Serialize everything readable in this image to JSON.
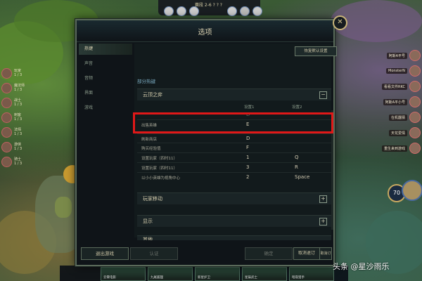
{
  "hud": {
    "stage": "赛段 2-6  ? ? ?",
    "left_players": [
      {
        "name": "玩家\n1 / 3"
      },
      {
        "name": "魔法师\n1 / 3"
      },
      {
        "name": "战士\n1 / 3"
      },
      {
        "name": "刺客\n1 / 3"
      },
      {
        "name": "法师\n1 / 3"
      },
      {
        "name": "游侠\n1 / 3"
      },
      {
        "name": "骑士\n1 / 3"
      }
    ],
    "right_players": [
      {
        "name": "阿斯A平号"
      },
      {
        "name": "MonsterN"
      },
      {
        "name": "看看文件RKC"
      },
      {
        "name": "阿斯A平小号"
      },
      {
        "name": "在机器猜"
      },
      {
        "name": "天花爱情"
      },
      {
        "name": "重生来到游戏"
      }
    ],
    "level": "70",
    "bench_cards": [
      {
        "name": "云霄电影"
      },
      {
        "name": "九尾狐狸"
      },
      {
        "name": "新星护卫"
      },
      {
        "name": "星辰武士"
      },
      {
        "name": "暗夜猎手"
      }
    ]
  },
  "dialog": {
    "title": "选项",
    "close_glyph": "✕",
    "nav": [
      {
        "label": "热键",
        "active": true
      },
      {
        "label": "声音",
        "active": false
      },
      {
        "label": "音频",
        "active": false
      },
      {
        "label": "界面",
        "active": false
      },
      {
        "label": "游戏",
        "active": false
      }
    ],
    "restore_label": "恢复默认设置",
    "section_label": "部分热键",
    "groups": {
      "cloud": "云顶之弈",
      "move": "玩家移动",
      "display": "显示",
      "other": "其他"
    },
    "toggles": {
      "minus": "−",
      "plus": "+"
    },
    "columns": {
      "key1": "设置1",
      "key2": "设置2"
    },
    "rows": [
      {
        "name": "",
        "key1": "D",
        "key2": ""
      },
      {
        "name": "出售英雄",
        "key1": "E",
        "key2": ""
      },
      {
        "name": "刷新商店",
        "key1": "D",
        "key2": ""
      },
      {
        "name": "购买经验值",
        "key1": "F",
        "key2": ""
      },
      {
        "name": "设置玩家（四时11）",
        "key1": "1",
        "key2": "Q"
      },
      {
        "name": "设置玩家（四时11）",
        "key1": "3",
        "key2": "R"
      },
      {
        "name": "以小小英雄为视角中心",
        "key1": "2",
        "key2": "Space"
      }
    ],
    "footer": {
      "exit": "退出游戏",
      "confirm_left": "认证",
      "ok": "确定",
      "cancel_wide": "取消退订",
      "cancel": "取消订"
    }
  },
  "watermark": "头条 @星沙雨乐",
  "colors": {
    "highlight": "#e01818",
    "accent": "#c8b478"
  }
}
